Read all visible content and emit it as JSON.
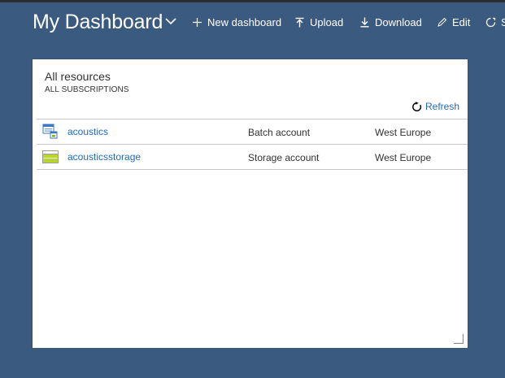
{
  "header": {
    "title": "My Dashboard",
    "toolbar": {
      "new_dashboard": "New dashboard",
      "upload": "Upload",
      "download": "Download",
      "edit": "Edit",
      "share": "S"
    }
  },
  "tile": {
    "title": "All resources",
    "subtitle": "ALL SUBSCRIPTIONS",
    "refresh_label": "Refresh",
    "resources": [
      {
        "name": "acoustics",
        "type": "Batch account",
        "location": "West Europe",
        "icon": "batch-account-icon"
      },
      {
        "name": "acousticsstorage",
        "type": "Storage account",
        "location": "West Europe",
        "icon": "storage-account-icon"
      }
    ]
  },
  "colors": {
    "background": "#3b5a7f",
    "link": "#1f6bb8",
    "text": "#323232"
  }
}
